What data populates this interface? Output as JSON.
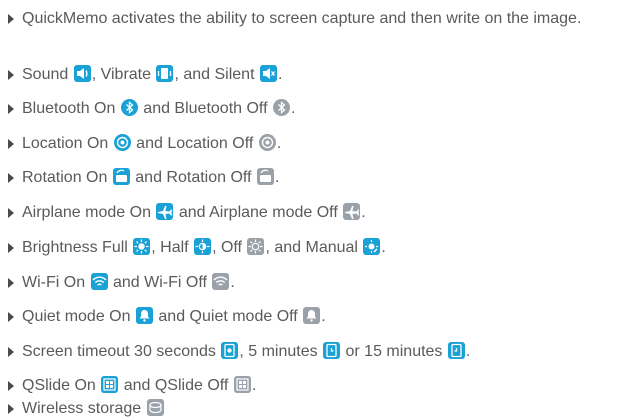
{
  "colors": {
    "text": "#5a5a5a",
    "bullet": "#4a4a4a",
    "icon_on": "#1aa1d6",
    "icon_off": "#9aa1a8"
  },
  "items": [
    {
      "segments": [
        "QuickMemo activates the ability to screen capture and then write on the image."
      ],
      "icons": []
    },
    {
      "segments": [
        "Sound ",
        ", Vibrate ",
        ", and Silent ",
        "."
      ],
      "icons": [
        "sound-on-icon",
        "vibrate-icon",
        "silent-icon"
      ]
    },
    {
      "segments": [
        "Bluetooth On ",
        " and Bluetooth Off ",
        "."
      ],
      "icons": [
        "bluetooth-on-icon",
        "bluetooth-off-icon"
      ]
    },
    {
      "segments": [
        "Location On ",
        " and Location Off ",
        "."
      ],
      "icons": [
        "location-on-icon",
        "location-off-icon"
      ]
    },
    {
      "segments": [
        "Rotation On ",
        " and Rotation Off ",
        "."
      ],
      "icons": [
        "rotation-on-icon",
        "rotation-off-icon"
      ]
    },
    {
      "segments": [
        "Airplane mode On ",
        " and Airplane mode Off ",
        "."
      ],
      "icons": [
        "airplane-on-icon",
        "airplane-off-icon"
      ]
    },
    {
      "segments": [
        "Brightness Full ",
        ", Half ",
        ", Off ",
        ", and Manual ",
        "."
      ],
      "icons": [
        "brightness-full-icon",
        "brightness-half-icon",
        "brightness-off-icon",
        "brightness-manual-icon"
      ]
    },
    {
      "segments": [
        "Wi-Fi On ",
        " and Wi-Fi Off ",
        "."
      ],
      "icons": [
        "wifi-on-icon",
        "wifi-off-icon"
      ]
    },
    {
      "segments": [
        "Quiet mode On ",
        " and Quiet mode Off ",
        "."
      ],
      "icons": [
        "quiet-mode-on-icon",
        "quiet-mode-off-icon"
      ]
    },
    {
      "segments": [
        "Screen timeout 30 seconds ",
        ", 5 minutes ",
        " or 15 minutes ",
        "."
      ],
      "icons": [
        "timeout-30s-icon",
        "timeout-5m-icon",
        "timeout-15m-icon"
      ]
    },
    {
      "segments": [
        "QSlide On ",
        " and QSlide Off ",
        "."
      ],
      "icons": [
        "qslide-on-icon",
        "qslide-off-icon"
      ]
    },
    {
      "segments": [
        "Wireless storage ",
        ""
      ],
      "icons": [
        "wireless-storage-icon"
      ]
    }
  ]
}
